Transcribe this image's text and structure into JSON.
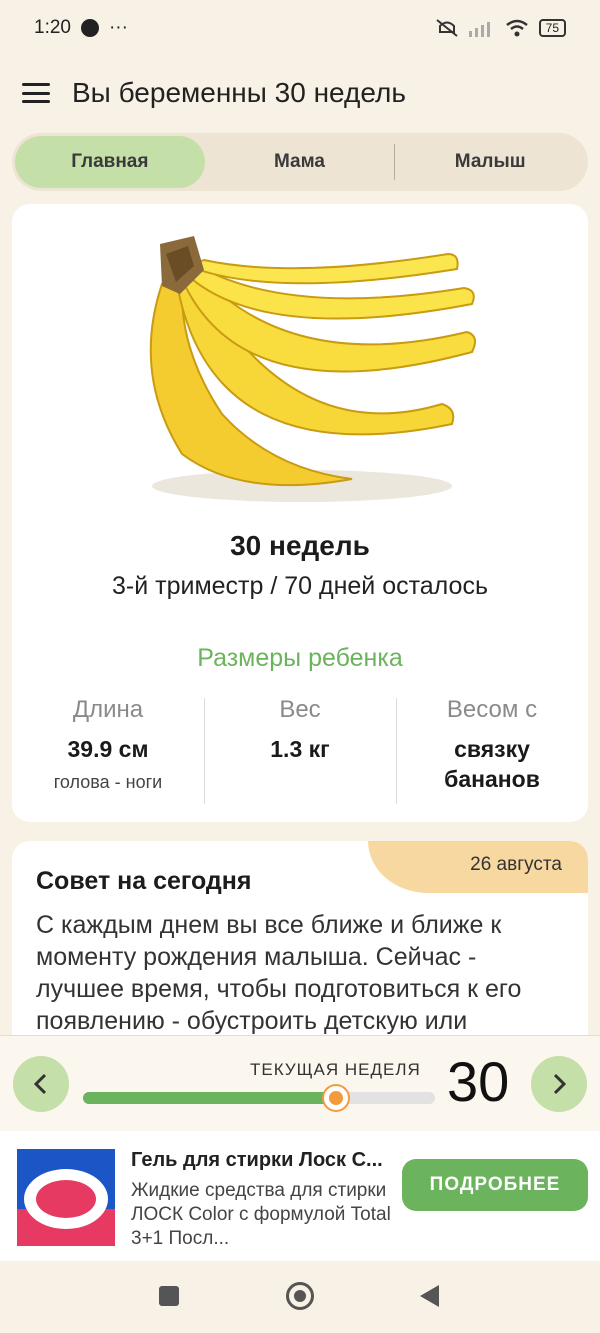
{
  "status": {
    "time": "1:20",
    "more": "···",
    "battery": "75"
  },
  "appbar": {
    "title": "Вы беременны 30 недель"
  },
  "tabs": [
    {
      "label": "Главная",
      "active": true
    },
    {
      "label": "Мама",
      "active": false
    },
    {
      "label": "Малыш",
      "active": false
    }
  ],
  "summary": {
    "image": "banana-bunch",
    "week_title": "30 недель",
    "trimester": "3-й триместр / 70 дней осталось",
    "sizes_title": "Размеры ребенка",
    "stats": [
      {
        "label": "Длина",
        "value": "39.9 см",
        "sub": "голова - ноги"
      },
      {
        "label": "Вес",
        "value": "1.3 кг",
        "sub": ""
      },
      {
        "label": "Весом с",
        "value": "связку бананов",
        "sub": ""
      }
    ]
  },
  "tip": {
    "date": "26 августа",
    "title": "Совет на сегодня",
    "text": "С каждым днем вы все ближе и ближе к моменту рождения малыша. Сейчас - лучшее время, чтобы подготовиться к его появлению - обустроить детскую или"
  },
  "week_selector": {
    "label": "ТЕКУЩАЯ НЕДЕЛЯ",
    "week": "30",
    "progress": 0.72,
    "prev_icon": "chevron-left-icon",
    "next_icon": "chevron-right-icon"
  },
  "ad": {
    "title": "Гель для стирки Лоск С...",
    "desc": "Жидкие средства для стирки ЛОСК Color с формулой Total 3+1 Посл...",
    "button": "ПОДРОБНЕЕ"
  },
  "colors": {
    "accent": "#6bb35c",
    "tab_active": "#c5dfa8",
    "background": "#f8f1e5",
    "thumb": "#f39b3a"
  }
}
